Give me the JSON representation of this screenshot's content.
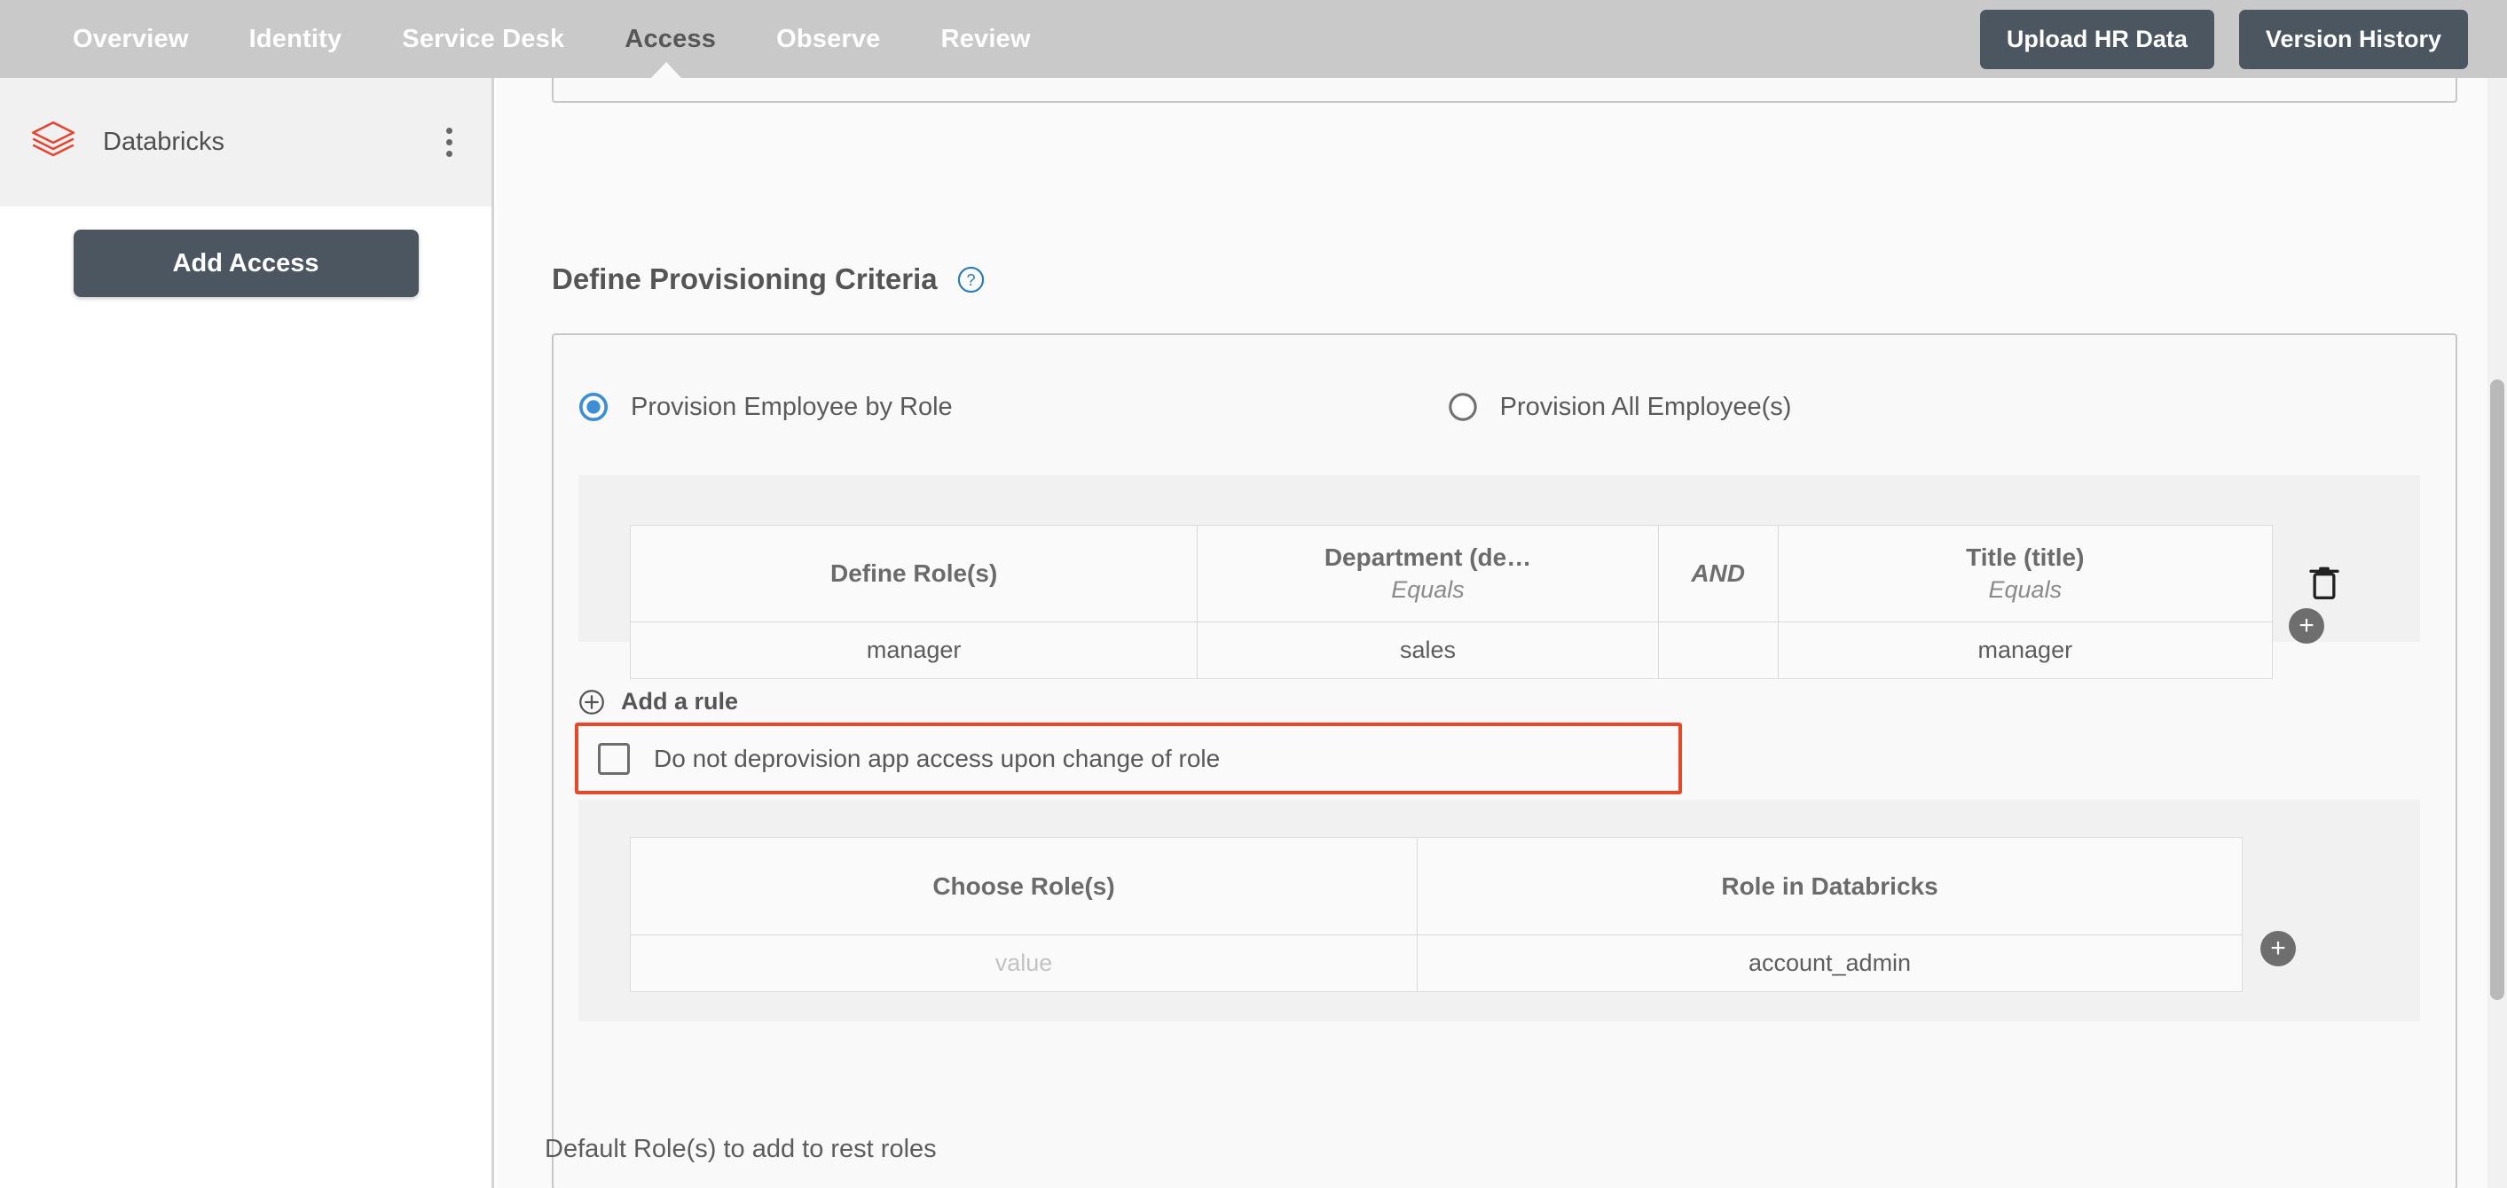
{
  "topnav": {
    "items": [
      {
        "label": "Overview",
        "active": false
      },
      {
        "label": "Identity",
        "active": false
      },
      {
        "label": "Service Desk",
        "active": false
      },
      {
        "label": "Access",
        "active": true
      },
      {
        "label": "Observe",
        "active": false
      },
      {
        "label": "Review",
        "active": false
      }
    ],
    "upload_button": "Upload HR Data",
    "version_button": "Version History",
    "bg_color": "#c9c9c9",
    "button_color": "#4b5660"
  },
  "sidebar": {
    "app": {
      "name": "Databricks",
      "logo_icon": "databricks-layers-icon",
      "logo_color": "#e8432e",
      "menu_icon": "kebab-menu-icon"
    },
    "add_access_button": "Add Access"
  },
  "main": {
    "section_title": "Define Provisioning Criteria",
    "help_icon": "question-circle-icon",
    "help_icon_color": "#2b7cb8",
    "provisioning_mode": {
      "options": [
        {
          "label": "Provision Employee by Role",
          "selected": true
        },
        {
          "label": "Provision All Employee(s)",
          "selected": false
        }
      ],
      "selected_color": "#3d8ed4"
    },
    "rule_table": {
      "columns": [
        {
          "title": "Define Role(s)",
          "operator": ""
        },
        {
          "title": "Department (de…",
          "operator": "Equals"
        },
        {
          "title": "AND",
          "operator": ""
        },
        {
          "title": "Title (title)",
          "operator": "Equals"
        }
      ],
      "row": {
        "define_roles": "manager",
        "department": "sales",
        "title": "manager"
      },
      "delete_icon": "trash-icon",
      "add_icon": "plus-circle-icon"
    },
    "add_rule": {
      "label": "Add a rule",
      "icon": "plus-circle-outline-icon"
    },
    "deprovision_option": {
      "label": "Do not deprovision app access upon change of role",
      "checked": false,
      "highlight_color": "#e8482a"
    },
    "role_table": {
      "columns": [
        {
          "title": "Choose Role(s)"
        },
        {
          "title": "Role in Databricks"
        }
      ],
      "row": {
        "choose_roles_placeholder": "value",
        "role_in_app": "account_admin"
      },
      "add_icon": "plus-circle-icon"
    },
    "default_roles_label": "Default Role(s) to add to rest roles"
  }
}
